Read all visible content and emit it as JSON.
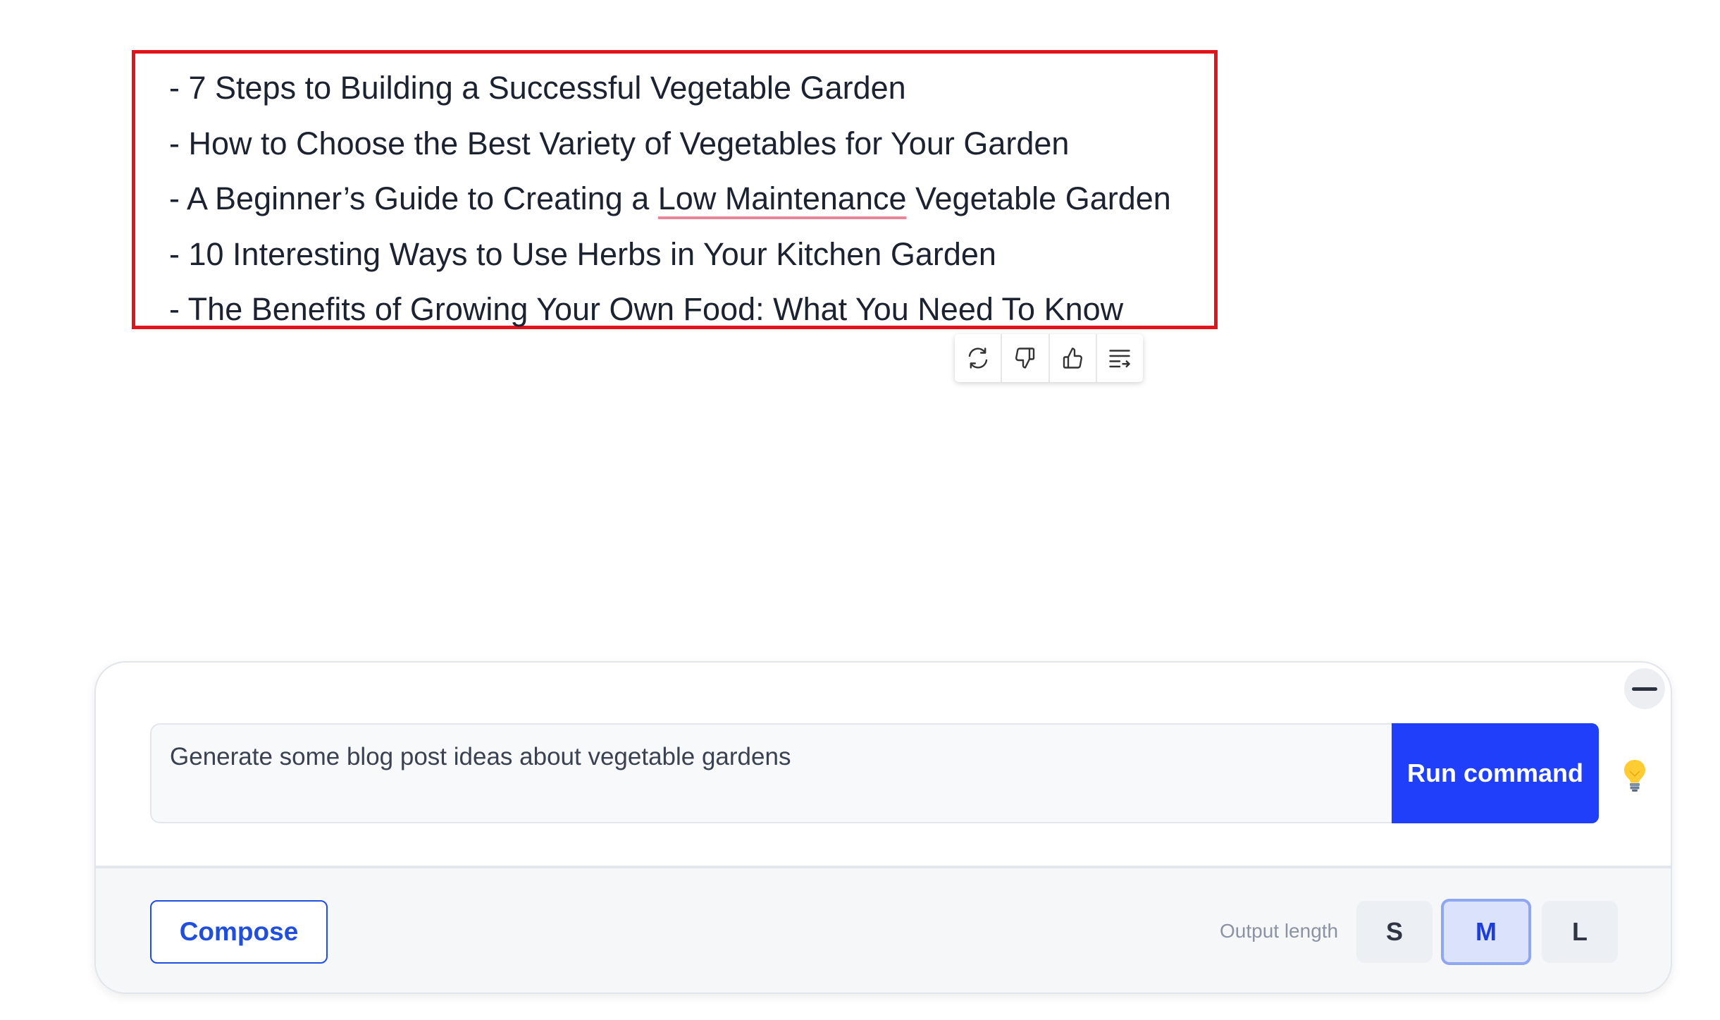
{
  "output": {
    "items": [
      {
        "prefix": "- 7 Steps to Building a Successful Vegetable Garden",
        "mark": "",
        "suffix": ""
      },
      {
        "prefix": "- How to Choose the Best Variety of Vegetables for Your Garden",
        "mark": "",
        "suffix": ""
      },
      {
        "prefix": "- A Beginner’s Guide to Creating a ",
        "mark": "Low Maintenance",
        "suffix": " Vegetable Garden"
      },
      {
        "prefix": "- 10 Interesting Ways to Use Herbs in Your Kitchen Garden",
        "mark": "",
        "suffix": ""
      },
      {
        "prefix": "- The Benefits of Growing Your Own Food: What You Need To Know",
        "mark": "",
        "suffix": ""
      }
    ],
    "highlight_color": "#e3131b",
    "spellcheck_underline_color": "#e9879a"
  },
  "feedback": {
    "buttons": [
      "regenerate-icon",
      "thumbs-down-icon",
      "thumbs-up-icon",
      "insert-text-icon"
    ]
  },
  "command": {
    "prompt_value": "Generate some blog post ideas about vegetable gardens",
    "run_label": "Run command",
    "run_color": "#1f3ffb",
    "hint_icon": "lightbulb-icon",
    "collapse_icon": "minus-icon"
  },
  "footer": {
    "compose_label": "Compose",
    "output_length_label": "Output length",
    "length_options": [
      "S",
      "M",
      "L"
    ],
    "selected_length": "M"
  }
}
